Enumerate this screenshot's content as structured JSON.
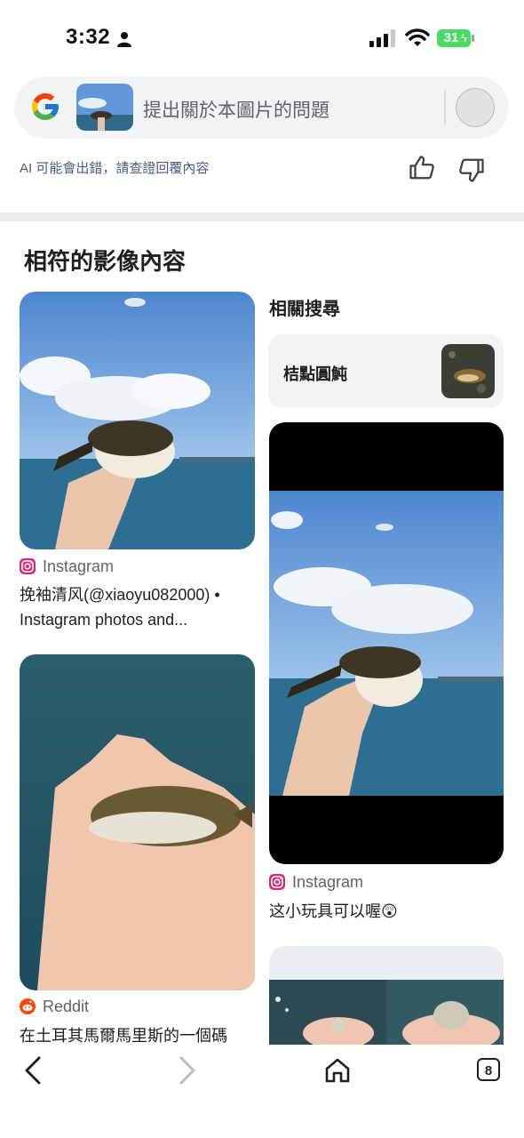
{
  "status": {
    "time": "3:32",
    "battery": "31"
  },
  "search": {
    "placeholder": "提出關於本圖片的問題"
  },
  "ai_notice": "AI 可能會出錯，請查證回覆內容",
  "section_title": "相符的影像內容",
  "related": {
    "title": "相關搜尋",
    "item_label": "桔點圓魨"
  },
  "results": [
    {
      "source": "Instagram",
      "title_line1": "挽袖清风(@xiaoyu082000) •",
      "title_line2": "Instagram photos and..."
    },
    {
      "source": "Reddit",
      "title_line1": "在土耳其馬爾馬里斯的一個碼"
    },
    {
      "source": "Instagram",
      "title_line1": "这小玩具可以喔😲"
    }
  ],
  "nav": {
    "tab_count": "8"
  },
  "colors": {
    "instagram": "#d62976",
    "reddit": "#ff4500",
    "separator": "#e8eaed",
    "search_bg": "#f1f3f4"
  }
}
